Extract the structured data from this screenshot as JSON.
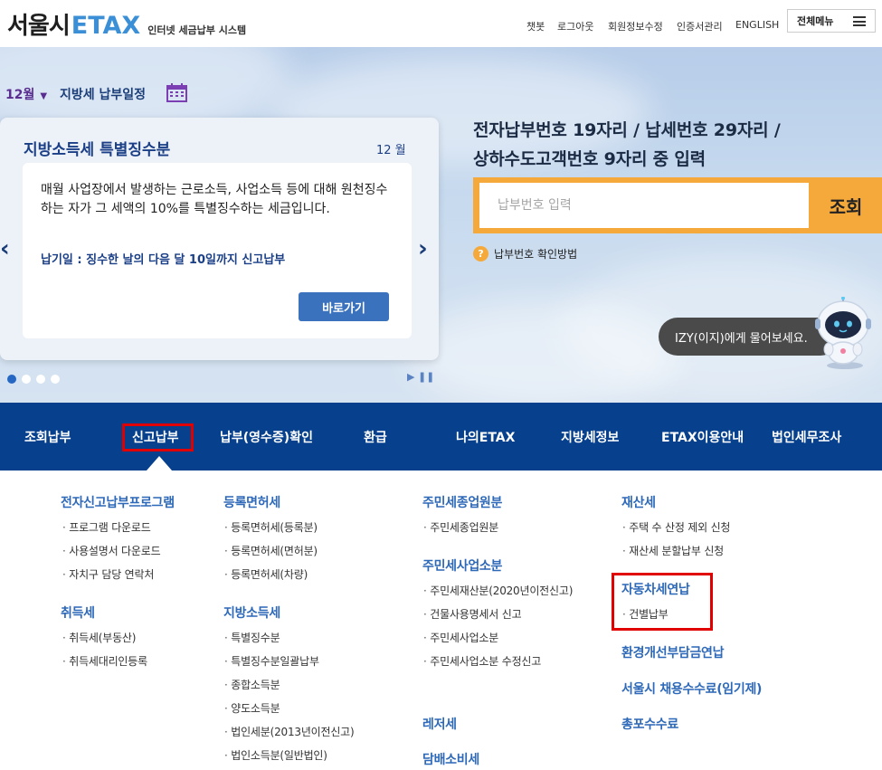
{
  "header": {
    "logo_kr": "서울시",
    "logo_en": "ETAX",
    "logo_sub": "인터넷 세금납부 시스템",
    "util_links": [
      "챗봇",
      "로그아웃",
      "회원정보수정",
      "인증서관리",
      "ENGLISH"
    ],
    "all_menu": "전체메뉴"
  },
  "schedule": {
    "month": "12월",
    "label": "지방세 납부일정"
  },
  "card": {
    "title": "지방소득세 특별징수분",
    "month": "12 월",
    "desc": "매월 사업장에서 발생하는 근로소득, 사업소득 등에 대해 원천징수 하는 자가 그 세액의 10%를 특별징수하는 세금입니다.",
    "due": "납기일 : 징수한 날의 다음 달 10일까지 신고납부",
    "go_label": "바로가기",
    "prev": "‹",
    "next": "›",
    "play_ctl": "▶ ❚❚"
  },
  "search": {
    "title_line1": "전자납부번호 19자리 / 납세번호 29자리 /",
    "title_line2": "상하수도고객번호 9자리 중 입력",
    "placeholder": "납부번호 입력",
    "button": "조회",
    "help": "납부번호 확인방법",
    "help_icon": "?"
  },
  "chatbot": {
    "bubble": "IZY(이지)에게 물어보세요."
  },
  "nav": {
    "items": [
      "조회납부",
      "신고납부",
      "납부(영수증)확인",
      "환급",
      "나의ETAX",
      "지방세정보",
      "ETAX이용안내",
      "법인세무조사"
    ]
  },
  "menu": {
    "col1": {
      "h1": "전자신고납부프로그램",
      "h1_items": [
        "프로그램 다운로드",
        "사용설명서 다운로드",
        "자치구 담당 연락처"
      ],
      "h2": "취득세",
      "h2_items": [
        "취득세(부동산)",
        "취득세대리인등록"
      ]
    },
    "col2": {
      "h1": "등록면허세",
      "h1_items": [
        "등록면허세(등록분)",
        "등록면허세(면허분)",
        "등록면허세(차량)"
      ],
      "h2": "지방소득세",
      "h2_items": [
        "특별징수분",
        "특별징수분일괄납부",
        "종합소득분",
        "양도소득분",
        "법인세분(2013년이전신고)",
        "법인소득분(일반법인)"
      ]
    },
    "col3": {
      "h1": "주민세종업원분",
      "h1_items": [
        "주민세종업원분"
      ],
      "h2": "주민세사업소분",
      "h2_items": [
        "주민세재산분(2020년이전신고)",
        "건물사용명세서 신고",
        "주민세사업소분",
        "주민세사업소분 수정신고"
      ],
      "h3": "레저세",
      "h4": "담배소비세"
    },
    "col4": {
      "h1": "재산세",
      "h1_items": [
        "주택 수 산정 제외 신청",
        "재산세 분할납부 신청"
      ],
      "h2": "자동차세연납",
      "h2_items": [
        "건별납부"
      ],
      "h3": "환경개선부담금연납",
      "h4": "서울시 채용수수료(임기제)",
      "h5": "총포수수료"
    }
  }
}
